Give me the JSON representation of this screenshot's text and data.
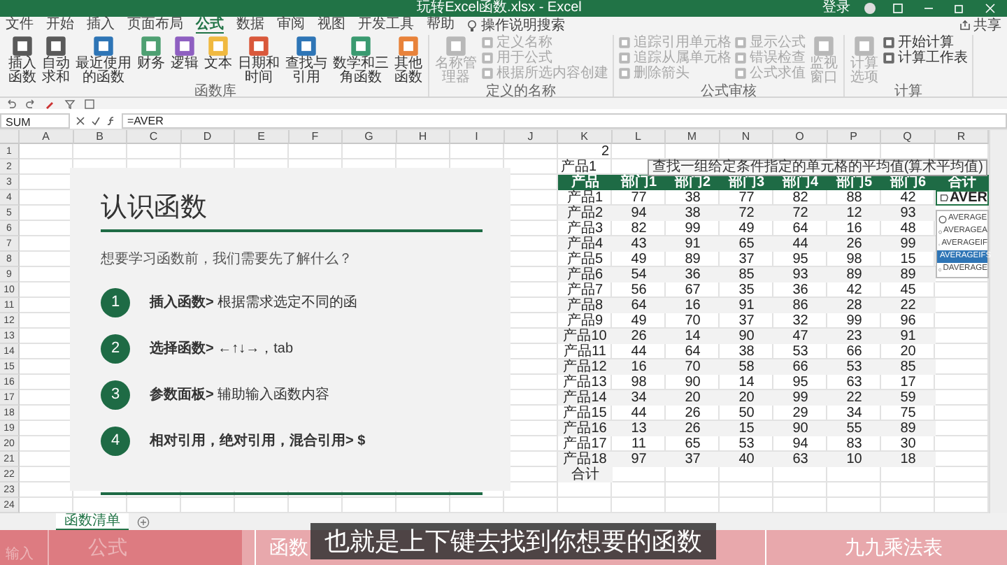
{
  "window": {
    "title": "玩转Excel函数.xlsx - Excel",
    "user": "登录",
    "share": "共享"
  },
  "menu_tabs": [
    {
      "label": "文件",
      "selected": false
    },
    {
      "label": "开始",
      "selected": false
    },
    {
      "label": "插入",
      "selected": false
    },
    {
      "label": "页面布局",
      "selected": false
    },
    {
      "label": "公式",
      "selected": true
    },
    {
      "label": "数据",
      "selected": false
    },
    {
      "label": "审阅",
      "selected": false
    },
    {
      "label": "视图",
      "selected": false
    },
    {
      "label": "开发工具",
      "selected": false
    },
    {
      "label": "帮助",
      "selected": false
    }
  ],
  "tell_me": "操作说明搜索",
  "ribbon": {
    "groups": [
      {
        "label": "函数库",
        "items": [
          {
            "label": "插入函数",
            "kind": "large",
            "color": "#5a5a5a",
            "disabled": false
          },
          {
            "label": "自动求和",
            "kind": "large",
            "color": "#5a5a5a",
            "disabled": false
          },
          {
            "label": "最近使用的函数",
            "kind": "large",
            "color": "#2e75b6",
            "disabled": false
          },
          {
            "label": "财务",
            "kind": "large",
            "color": "#4ea072",
            "disabled": false
          },
          {
            "label": "逻辑",
            "kind": "large",
            "color": "#8e5fc1",
            "disabled": false
          },
          {
            "label": "文本",
            "kind": "large",
            "color": "#f0b940",
            "disabled": false
          },
          {
            "label": "日期和时间",
            "kind": "large",
            "color": "#d9583b",
            "disabled": false
          },
          {
            "label": "查找与引用",
            "kind": "large",
            "color": "#2e75b6",
            "disabled": false
          },
          {
            "label": "数学和三角函数",
            "kind": "large",
            "color": "#3a9a70",
            "disabled": false
          },
          {
            "label": "其他函数",
            "kind": "large",
            "color": "#e8823a",
            "disabled": false
          }
        ]
      },
      {
        "label": "定义的名称",
        "items": [
          {
            "label": "名称管理器",
            "kind": "large",
            "color": "#b8b8b8",
            "disabled": true
          },
          {
            "label": "定义名称",
            "kind": "small",
            "color": "#b8b8b8",
            "disabled": true
          },
          {
            "label": "用于公式",
            "kind": "small",
            "color": "#b8b8b8",
            "disabled": true
          },
          {
            "label": "根据所选内容创建",
            "kind": "small",
            "color": "#b8b8b8",
            "disabled": true
          }
        ]
      },
      {
        "label": "公式审核",
        "items": [
          {
            "label": "追踪引用单元格",
            "kind": "small",
            "color": "#b8b8b8",
            "disabled": true
          },
          {
            "label": "追踪从属单元格",
            "kind": "small",
            "color": "#b8b8b8",
            "disabled": true
          },
          {
            "label": "删除箭头",
            "kind": "small",
            "color": "#b8b8b8",
            "disabled": true
          },
          {
            "label": "显示公式",
            "kind": "small",
            "color": "#b8b8b8",
            "disabled": true
          },
          {
            "label": "错误检查",
            "kind": "small",
            "color": "#b8b8b8",
            "disabled": true
          },
          {
            "label": "公式求值",
            "kind": "small",
            "color": "#b8b8b8",
            "disabled": true
          },
          {
            "label": "监视窗口",
            "kind": "large",
            "color": "#b8b8b8",
            "disabled": true
          }
        ]
      },
      {
        "label": "计算",
        "items": [
          {
            "label": "计算选项",
            "kind": "large",
            "color": "#b8b8b8",
            "disabled": true
          },
          {
            "label": "开始计算",
            "kind": "small",
            "color": "#6a6a6a",
            "disabled": false
          },
          {
            "label": "计算工作表",
            "kind": "small",
            "color": "#6a6a6a",
            "disabled": false
          }
        ]
      }
    ]
  },
  "formula_bar": {
    "name_box": "SUM",
    "formula": "=AVER"
  },
  "sheet": {
    "columns": [
      "A",
      "B",
      "C",
      "D",
      "E",
      "F",
      "G",
      "H",
      "I",
      "J",
      "K",
      "L",
      "M",
      "N",
      "O",
      "P",
      "Q",
      "R"
    ],
    "rows": [
      "1",
      "2",
      "3",
      "4",
      "5",
      "6",
      "7",
      "8",
      "9",
      "10",
      "11",
      "12",
      "13",
      "14",
      "15",
      "16",
      "17",
      "18",
      "19",
      "20",
      "21",
      "22",
      "23",
      "24"
    ]
  },
  "table": {
    "note": "2",
    "caption": "产品1",
    "columns": [
      "产品",
      "部门1",
      "部门2",
      "部门3",
      "部门4",
      "部门5",
      "部门6",
      "合计"
    ],
    "rows": [
      [
        "产品1",
        "77",
        "38",
        "77",
        "82",
        "88",
        "42"
      ],
      [
        "产品2",
        "94",
        "38",
        "72",
        "72",
        "12",
        "93"
      ],
      [
        "产品3",
        "82",
        "99",
        "49",
        "64",
        "16",
        "48"
      ],
      [
        "产品4",
        "43",
        "91",
        "65",
        "44",
        "26",
        "99"
      ],
      [
        "产品5",
        "49",
        "89",
        "37",
        "95",
        "98",
        "15"
      ],
      [
        "产品6",
        "54",
        "36",
        "85",
        "93",
        "89",
        "89"
      ],
      [
        "产品7",
        "56",
        "67",
        "35",
        "36",
        "42",
        "45"
      ],
      [
        "产品8",
        "64",
        "16",
        "91",
        "86",
        "28",
        "22"
      ],
      [
        "产品9",
        "49",
        "70",
        "37",
        "32",
        "99",
        "96"
      ],
      [
        "产品10",
        "26",
        "14",
        "90",
        "47",
        "23",
        "91"
      ],
      [
        "产品11",
        "44",
        "64",
        "38",
        "53",
        "66",
        "20"
      ],
      [
        "产品12",
        "16",
        "70",
        "58",
        "66",
        "53",
        "85"
      ],
      [
        "产品13",
        "98",
        "90",
        "14",
        "95",
        "63",
        "17"
      ],
      [
        "产品14",
        "34",
        "20",
        "20",
        "99",
        "22",
        "59"
      ],
      [
        "产品15",
        "44",
        "26",
        "50",
        "29",
        "34",
        "75"
      ],
      [
        "产品16",
        "13",
        "26",
        "15",
        "90",
        "55",
        "89"
      ],
      [
        "产品17",
        "11",
        "65",
        "53",
        "94",
        "83",
        "30"
      ],
      [
        "产品18",
        "97",
        "37",
        "40",
        "63",
        "10",
        "18"
      ]
    ],
    "total_label": "合计",
    "editing_value": "AVER"
  },
  "autocomplete": {
    "items": [
      {
        "label": "AVERAGE",
        "selected": false
      },
      {
        "label": "AVERAGEA",
        "selected": false
      },
      {
        "label": "AVERAGEIF",
        "selected": false
      },
      {
        "label": "AVERAGEIFS",
        "selected": true
      },
      {
        "label": "DAVERAGE",
        "selected": false
      }
    ],
    "tooltip": "查找一组给定条件指定的单元格的平均值(算术平均值)"
  },
  "slide": {
    "title": "认识函数",
    "question": "想要学习函数前，我们需要先了解什么？",
    "steps": [
      {
        "number": "1",
        "text": "**插入函数>** 根据需求选定不同的函"
      },
      {
        "number": "2",
        "text": "**选择函数>** ←↑↓→，tab"
      },
      {
        "number": "3",
        "text": "**参数面板>** 辅助输入函数内容"
      },
      {
        "number": "4",
        "text": "**相对引用，绝对引用，混合引用> $**"
      }
    ]
  },
  "sheet_tabs": [
    {
      "label": "函数清单",
      "selected": true
    }
  ],
  "status": "输入",
  "video": {
    "chapters": [
      {
        "label": "公式"
      },
      {
        "label": "函数"
      },
      {
        "label": "九九乘法表"
      }
    ],
    "progress": {
      "level": 0.24
    },
    "subtitle": "也就是上下键去找到你想要的函数"
  }
}
